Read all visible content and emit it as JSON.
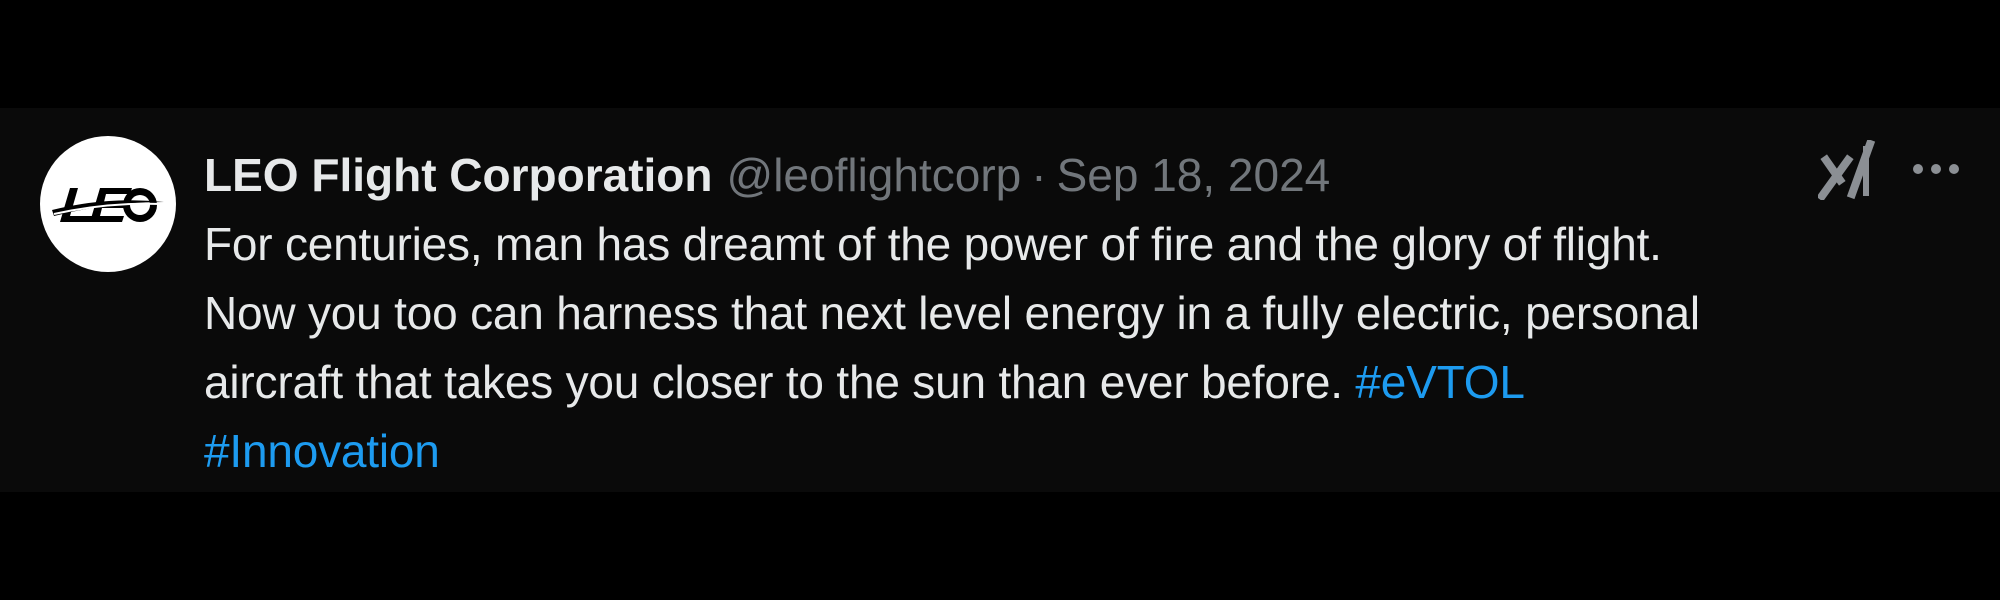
{
  "tweet": {
    "avatar": {
      "logo_text": "LEO"
    },
    "author": {
      "display_name": "LEO Flight Corporation",
      "handle": "@leoflightcorp"
    },
    "separator": "·",
    "date": "Sep 18, 2024",
    "body": {
      "text": "For centuries, man has dreamt of the power of fire and the glory of flight.\nNow you too can harness that next level energy in a fully electric, personal\naircraft that takes you closer to the sun than ever before. ",
      "hashtags": [
        "#eVTOL",
        "#Innovation"
      ]
    },
    "icons": {
      "grok": "grok-icon",
      "more": "more-options-icon"
    },
    "colors": {
      "background": "#000000",
      "card": "#0a0a0a",
      "text": "#e7e9ea",
      "secondary": "#71767b",
      "link": "#1d9bf0"
    }
  }
}
